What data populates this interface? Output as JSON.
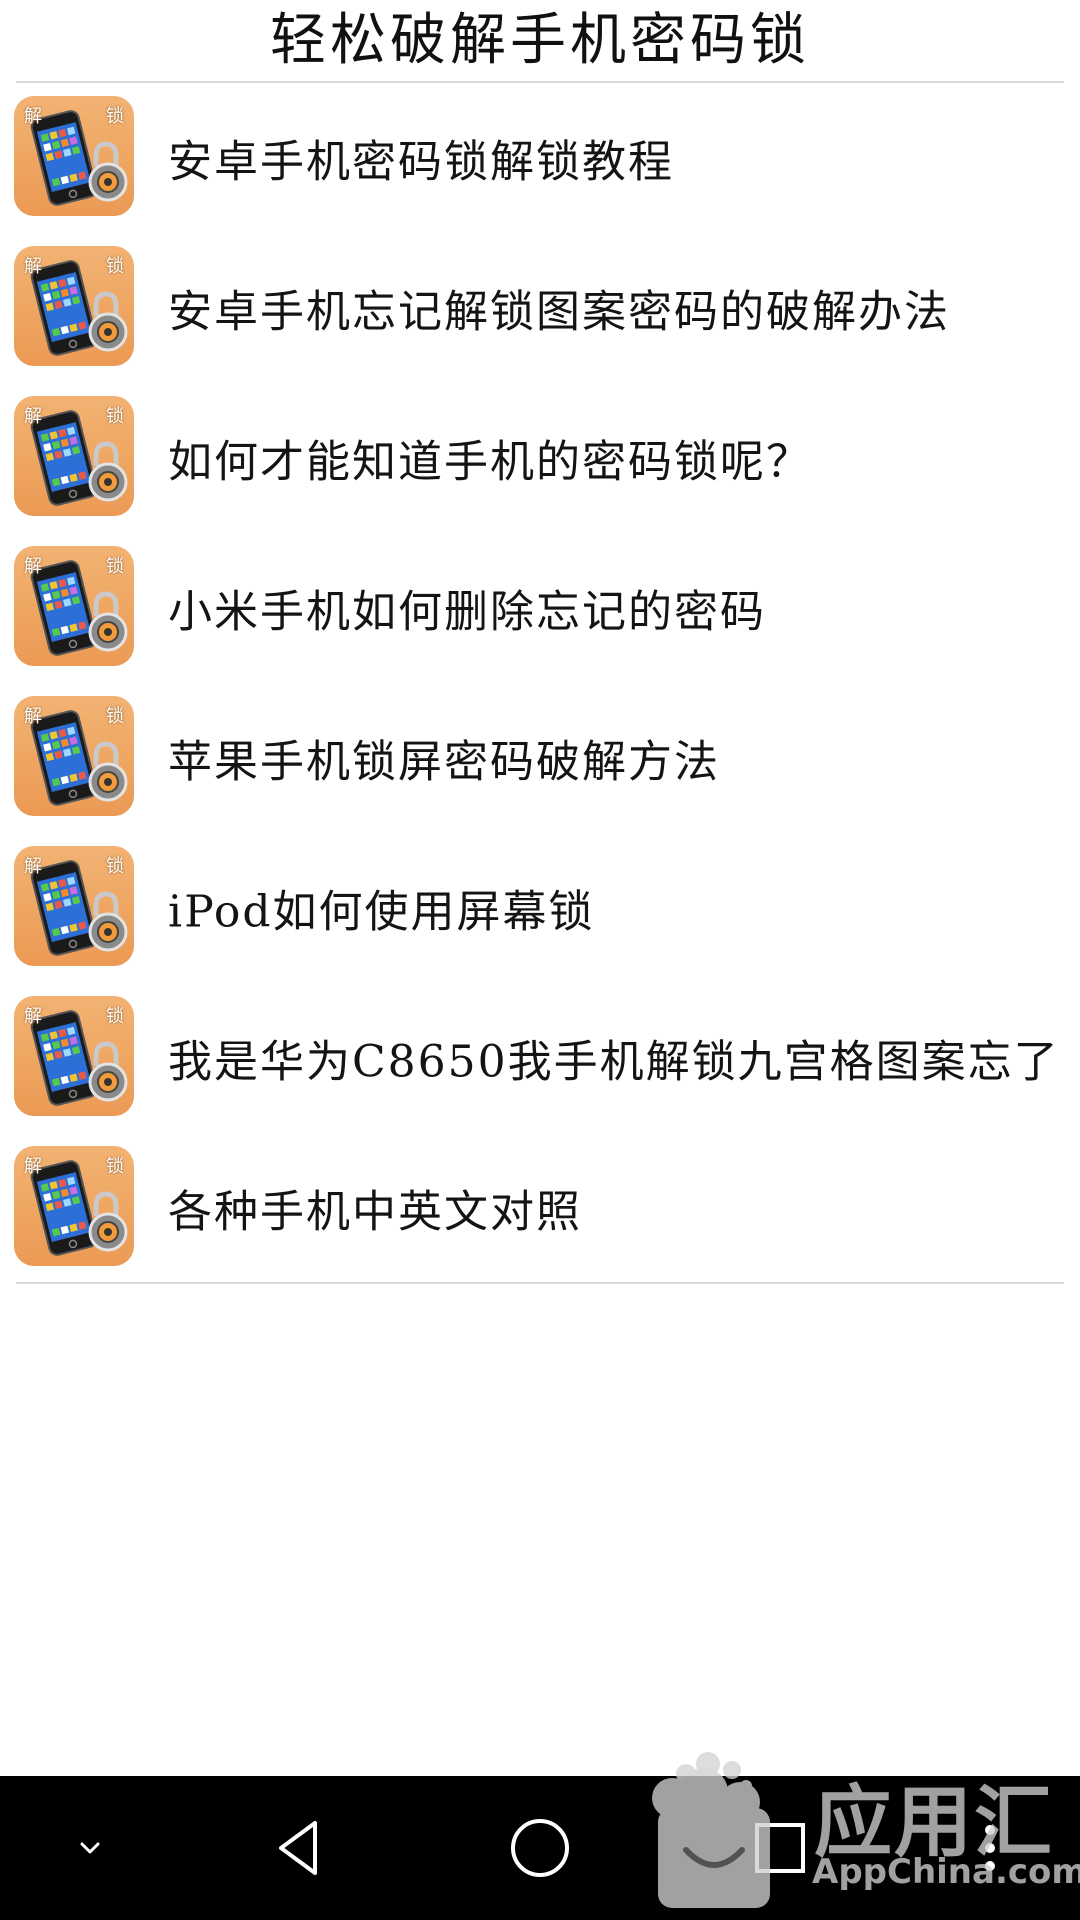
{
  "header": {
    "title": "轻松破解手机密码锁"
  },
  "list": {
    "icon": {
      "name": "unlock-app-icon",
      "char_left": "解",
      "char_right": "锁",
      "bg_color": "#eb9a54"
    },
    "items": [
      {
        "label": "安卓手机密码锁解锁教程"
      },
      {
        "label": "安卓手机忘记解锁图案密码的破解办法"
      },
      {
        "label": "如何才能知道手机的密码锁呢？"
      },
      {
        "label": "小米手机如何删除忘记的密码"
      },
      {
        "label": "苹果手机锁屏密码破解方法"
      },
      {
        "label": "iPod如何使用屏幕锁"
      },
      {
        "label": "我是华为C8650我手机解锁九宫格图案忘了"
      },
      {
        "label": "各种手机中英文对照"
      }
    ]
  },
  "navbar": {
    "buttons": [
      "chevron-down-icon",
      "back-icon",
      "home-icon",
      "recents-icon",
      "menu-dots-icon"
    ],
    "bg_color": "#000000"
  },
  "watermark": {
    "cn": "应用汇",
    "en": "AppChina.com"
  }
}
